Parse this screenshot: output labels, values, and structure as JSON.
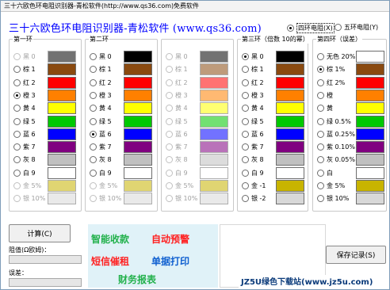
{
  "window": {
    "title": "三十六欧色环电阻识别器-青松软件(http://www.qs36.com)",
    "title_extra": "免费软件"
  },
  "header": {
    "text": "三十六欧色环电阻识别器-青松软件 (www.qs36.com)"
  },
  "mode": {
    "four_band": "四环电阻(X)",
    "five_band": "五环电阻(Y)",
    "selected": "four_band"
  },
  "groups": [
    {
      "title": "第一环",
      "rows": [
        {
          "label": "黑 0",
          "color": "#000000",
          "checked": false,
          "disabled": true
        },
        {
          "label": "棕 1",
          "color": "#8a4a10",
          "checked": false,
          "disabled": false
        },
        {
          "label": "红 2",
          "color": "#ff0000",
          "checked": false,
          "disabled": false
        },
        {
          "label": "橙 3",
          "color": "#ff8000",
          "checked": true,
          "disabled": false
        },
        {
          "label": "黄 4",
          "color": "#ffff00",
          "checked": false,
          "disabled": false
        },
        {
          "label": "绿 5",
          "color": "#00c800",
          "checked": false,
          "disabled": false
        },
        {
          "label": "蓝 6",
          "color": "#0000ff",
          "checked": false,
          "disabled": false
        },
        {
          "label": "紫 7",
          "color": "#800080",
          "checked": false,
          "disabled": false
        },
        {
          "label": "灰 8",
          "color": "#c0c0c0",
          "checked": false,
          "disabled": false
        },
        {
          "label": "白 9",
          "color": "#ffffff",
          "checked": false,
          "disabled": false
        },
        {
          "label": "金 5%",
          "color": "#c8b400",
          "checked": false,
          "disabled": true
        },
        {
          "label": "银 10%",
          "color": "#d8d8d8",
          "checked": false,
          "disabled": true
        }
      ]
    },
    {
      "title": "第二环",
      "rows": [
        {
          "label": "黑 0",
          "color": "#000000",
          "checked": false,
          "disabled": false
        },
        {
          "label": "棕 1",
          "color": "#8a4a10",
          "checked": false,
          "disabled": false
        },
        {
          "label": "红 2",
          "color": "#ff0000",
          "checked": false,
          "disabled": false
        },
        {
          "label": "橙 3",
          "color": "#ff8000",
          "checked": false,
          "disabled": false
        },
        {
          "label": "黄 4",
          "color": "#ffff00",
          "checked": false,
          "disabled": false
        },
        {
          "label": "绿 5",
          "color": "#00c800",
          "checked": false,
          "disabled": false
        },
        {
          "label": "蓝 6",
          "color": "#0000ff",
          "checked": true,
          "disabled": false
        },
        {
          "label": "紫 7",
          "color": "#800080",
          "checked": false,
          "disabled": false
        },
        {
          "label": "灰 8",
          "color": "#c0c0c0",
          "checked": false,
          "disabled": false
        },
        {
          "label": "白 9",
          "color": "#ffffff",
          "checked": false,
          "disabled": false
        },
        {
          "label": "金 5%",
          "color": "#c8b400",
          "checked": false,
          "disabled": true
        },
        {
          "label": "银 10%",
          "color": "#d8d8d8",
          "checked": false,
          "disabled": true
        }
      ]
    },
    {
      "title": "",
      "rows": [
        {
          "label": "黑 0",
          "color": "#000000",
          "checked": false,
          "disabled": true
        },
        {
          "label": "棕 1",
          "color": "#8a4a10",
          "checked": false,
          "disabled": true
        },
        {
          "label": "红 2",
          "color": "#ff0000",
          "checked": false,
          "disabled": true
        },
        {
          "label": "橙 3",
          "color": "#ff8000",
          "checked": false,
          "disabled": true
        },
        {
          "label": "黄 4",
          "color": "#ffff00",
          "checked": false,
          "disabled": true
        },
        {
          "label": "绿 5",
          "color": "#00c800",
          "checked": false,
          "disabled": true
        },
        {
          "label": "蓝 6",
          "color": "#0000ff",
          "checked": false,
          "disabled": true
        },
        {
          "label": "紫 7",
          "color": "#800080",
          "checked": false,
          "disabled": true
        },
        {
          "label": "灰 8",
          "color": "#c0c0c0",
          "checked": false,
          "disabled": true
        },
        {
          "label": "白 9",
          "color": "#ffffff",
          "checked": false,
          "disabled": true
        },
        {
          "label": "金 5%",
          "color": "#c8b400",
          "checked": false,
          "disabled": true
        },
        {
          "label": "银 10%",
          "color": "#d8d8d8",
          "checked": false,
          "disabled": true
        }
      ]
    },
    {
      "title": "第三环（倍数 10的幂）",
      "rows": [
        {
          "label": "黑 0",
          "color": "#000000",
          "checked": true,
          "disabled": false
        },
        {
          "label": "棕 1",
          "color": "#8a4a10",
          "checked": false,
          "disabled": false
        },
        {
          "label": "红 2",
          "color": "#ff0000",
          "checked": false,
          "disabled": false
        },
        {
          "label": "橙 3",
          "color": "#ff8000",
          "checked": false,
          "disabled": false
        },
        {
          "label": "黄 4",
          "color": "#ffff00",
          "checked": false,
          "disabled": false
        },
        {
          "label": "绿 5",
          "color": "#00c800",
          "checked": false,
          "disabled": false
        },
        {
          "label": "蓝 6",
          "color": "#0000ff",
          "checked": false,
          "disabled": false
        },
        {
          "label": "紫 7",
          "color": "#800080",
          "checked": false,
          "disabled": false
        },
        {
          "label": "灰 8",
          "color": "#c0c0c0",
          "checked": false,
          "disabled": false
        },
        {
          "label": "白 9",
          "color": "#ffffff",
          "checked": false,
          "disabled": false
        },
        {
          "label": "金 -1",
          "color": "#c8b400",
          "checked": false,
          "disabled": false
        },
        {
          "label": "银 -2",
          "color": "#d8d8d8",
          "checked": false,
          "disabled": false
        }
      ]
    },
    {
      "title": "第四环（误差）",
      "rows": [
        {
          "label": "无色 20%",
          "color": "#ffffff",
          "checked": false,
          "disabled": false
        },
        {
          "label": "棕 1%",
          "color": "#8a4a10",
          "checked": true,
          "disabled": false
        },
        {
          "label": "红 2%",
          "color": "#ff0000",
          "checked": false,
          "disabled": false
        },
        {
          "label": "橙",
          "color": "#ff8000",
          "checked": false,
          "disabled": false
        },
        {
          "label": "黄",
          "color": "#ffff00",
          "checked": false,
          "disabled": false
        },
        {
          "label": "绿 0.5%",
          "color": "#00c800",
          "checked": false,
          "disabled": false
        },
        {
          "label": "蓝 0.25%",
          "color": "#0000ff",
          "checked": false,
          "disabled": false
        },
        {
          "label": "紫 0.10%",
          "color": "#800080",
          "checked": false,
          "disabled": false
        },
        {
          "label": "灰 0.05%",
          "color": "#c0c0c0",
          "checked": false,
          "disabled": false
        },
        {
          "label": "白",
          "color": "#ffffff",
          "checked": false,
          "disabled": false
        },
        {
          "label": "金 5%",
          "color": "#c8b400",
          "checked": false,
          "disabled": false
        },
        {
          "label": "银 10%",
          "color": "#d8d8d8",
          "checked": false,
          "disabled": false
        }
      ]
    }
  ],
  "actions": {
    "calc_label": "计算(C)",
    "save_label": "保存记录(S)"
  },
  "results": {
    "resistance_label": "阻值(Ω欧姆)：",
    "resistance_value": "",
    "tolerance_label": "误差：",
    "tolerance_value": ""
  },
  "ad": {
    "line1a": "智能收款",
    "line1b": "自动预警",
    "line2a": "短信催租",
    "line2b": "单据打印",
    "line3": "财务报表"
  },
  "watermark": {
    "text": "JZ5U绿色下载站(www.jz5u.com)"
  },
  "colors": {
    "header_blue": "#0000ff",
    "ad_green": "#22b14c",
    "ad_red": "#ff2020",
    "ad_blue": "#1060d0",
    "ad_background": "#e0f2f8"
  }
}
